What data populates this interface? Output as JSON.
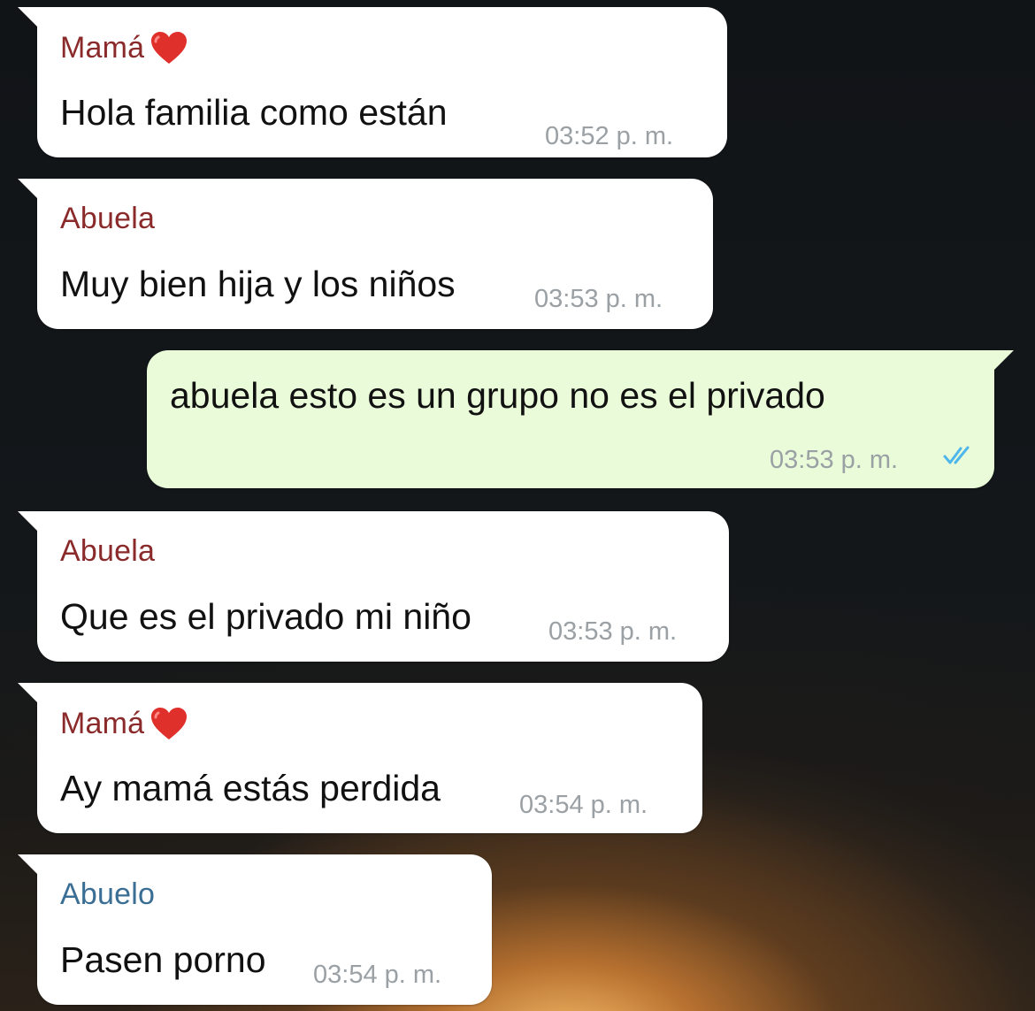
{
  "messages": [
    {
      "sender": "Mamá",
      "sender_icon": "heart-icon",
      "text": "Hola familia como están",
      "time": "03:52 p. m.",
      "direction": "incoming"
    },
    {
      "sender": "Abuela",
      "text": "Muy bien hija y los niños",
      "time": "03:53 p. m.",
      "direction": "incoming"
    },
    {
      "text": "abuela esto es un grupo no es el privado",
      "time": "03:53 p. m.",
      "direction": "outgoing",
      "status_icon": "double-check-read-icon"
    },
    {
      "sender": "Abuela",
      "text": "Que es el privado mi niño",
      "time": "03:53 p. m.",
      "direction": "incoming"
    },
    {
      "sender": "Mamá",
      "sender_icon": "heart-icon",
      "text": "Ay mamá estás perdida",
      "time": "03:54 p. m.",
      "direction": "incoming"
    },
    {
      "sender": "Abuelo",
      "text": "Pasen porno",
      "time": "03:54 p. m.",
      "direction": "incoming"
    }
  ],
  "colors": {
    "incoming_bubble": "#ffffff",
    "outgoing_bubble": "#e9fbd9",
    "sender_mama": "#8b2a2a",
    "sender_abuela": "#8b2a2a",
    "sender_abuelo": "#3a6e94",
    "timestamp": "#9aa0a4",
    "read_ticks": "#4fb6ec"
  }
}
